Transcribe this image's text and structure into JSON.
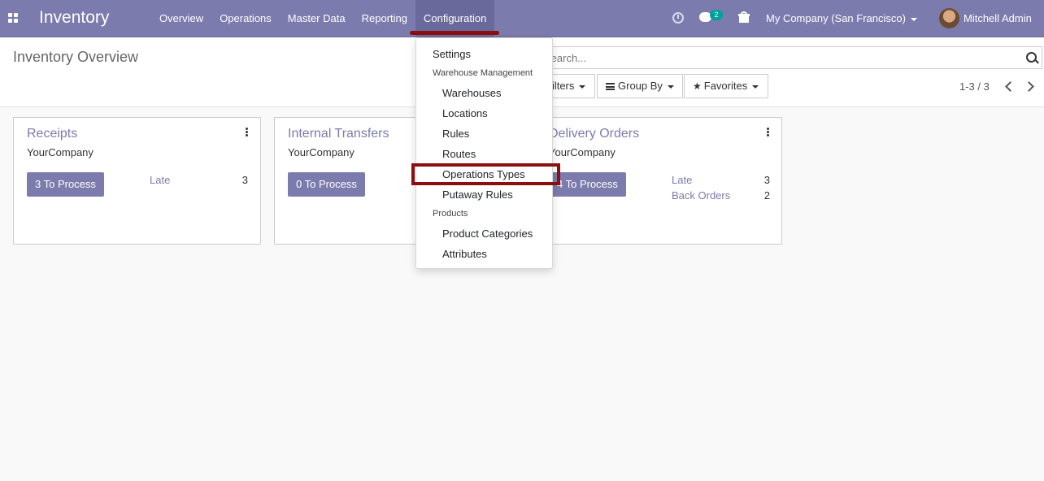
{
  "navbar": {
    "brand": "Inventory",
    "menu": [
      {
        "label": "Overview"
      },
      {
        "label": "Operations"
      },
      {
        "label": "Master Data"
      },
      {
        "label": "Reporting"
      },
      {
        "label": "Configuration"
      }
    ],
    "messages_badge": "2",
    "company": "My Company (San Francisco)",
    "user": "Mitchell Admin",
    "colors": {
      "bar": "#7c7bad",
      "active": "#6a699b",
      "annotation": "#8b0f10"
    }
  },
  "control_panel": {
    "title": "Inventory Overview",
    "search_placeholder": "Search...",
    "filters_label": "Filters",
    "groupby_label": "Group By",
    "favorites_label": "Favorites",
    "pager": "1-3 / 3"
  },
  "cards": [
    {
      "title": "Receipts",
      "company": "YourCompany",
      "process_label": "3 To Process",
      "stats": [
        {
          "label": "Late",
          "value": "3"
        }
      ]
    },
    {
      "title": "Internal Transfers",
      "company": "YourCompany",
      "process_label": "0 To Process",
      "stats": []
    },
    {
      "title": "Delivery Orders",
      "company": "YourCompany",
      "process_label": "4 To Process",
      "stats": [
        {
          "label": "Late",
          "value": "3"
        },
        {
          "label": "Back Orders",
          "value": "2"
        }
      ]
    }
  ],
  "config_menu": {
    "settings": "Settings",
    "warehouse_header": "Warehouse Management",
    "warehouse_items": [
      "Warehouses",
      "Locations",
      "Rules",
      "Routes",
      "Operations Types",
      "Putaway Rules"
    ],
    "products_header": "Products",
    "product_items": [
      "Product Categories",
      "Attributes"
    ],
    "highlighted": "Operations Types"
  }
}
